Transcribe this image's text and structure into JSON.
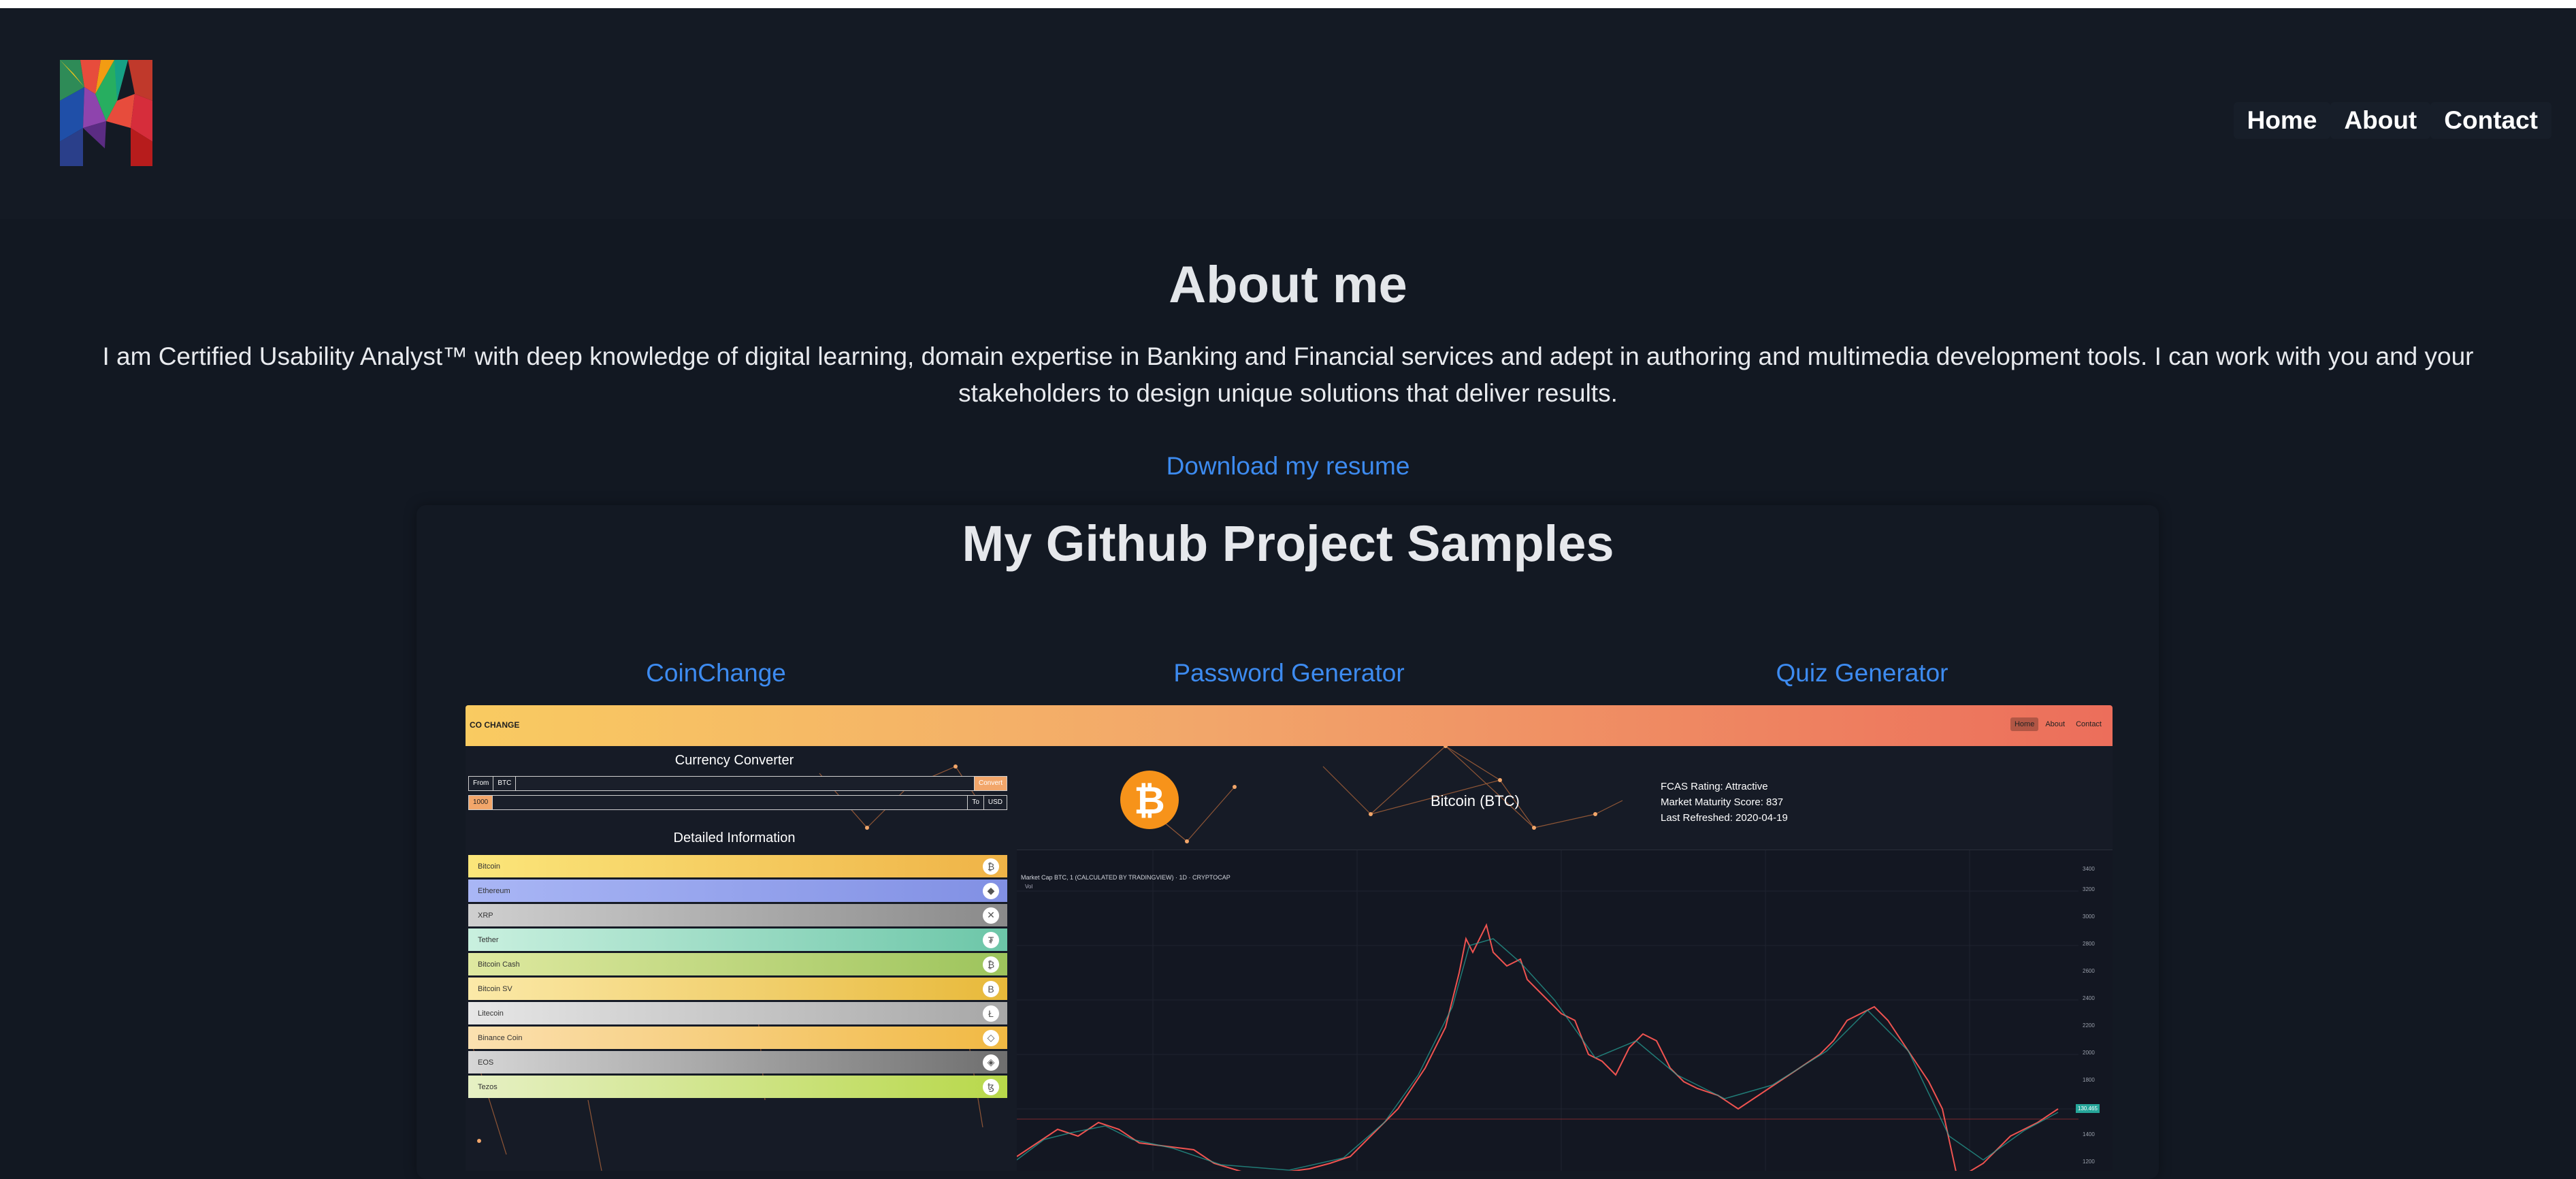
{
  "header": {
    "logo_alt": "M",
    "nav": [
      {
        "label": "Home"
      },
      {
        "label": "About"
      },
      {
        "label": "Contact"
      }
    ]
  },
  "about": {
    "title": "About me",
    "text": "I am Certified Usability Analyst™ with deep knowledge of digital learning, domain expertise in Banking and Financial services and adept in authoring and multimedia development tools. I can work with you and your stakeholders to design unique solutions that deliver results.",
    "resume_link": "Download my resume"
  },
  "github": {
    "title": "My Github Project Samples",
    "projects": [
      {
        "label": "CoinChange"
      },
      {
        "label": "Password Generator"
      },
      {
        "label": "Quiz Generator"
      }
    ]
  },
  "preview": {
    "brand": "CO   CHANGE",
    "nav": [
      "Home",
      "About",
      "Contact"
    ],
    "converter_title": "Currency Converter",
    "from_label": "From",
    "from_value": "BTC",
    "convert_label": "Convert",
    "amount_value": "1000",
    "to_label": "To",
    "to_value": "USD",
    "detail_title": "Detailed Information",
    "coins": [
      {
        "name": "Bitcoin",
        "icon": "₿",
        "color_a": "#fbe67a",
        "color_b": "#efb347"
      },
      {
        "name": "Ethereum",
        "icon": "◆",
        "color_a": "#a9b6f5",
        "color_b": "#8190e4"
      },
      {
        "name": "XRP",
        "icon": "✕",
        "color_a": "#cfcfcf",
        "color_b": "#8a8a8a"
      },
      {
        "name": "Tether",
        "icon": "₮",
        "color_a": "#c9f0df",
        "color_b": "#6cc6a8"
      },
      {
        "name": "Bitcoin Cash",
        "icon": "₿",
        "color_a": "#dfe9a0",
        "color_b": "#9dc45c"
      },
      {
        "name": "Bitcoin SV",
        "icon": "B",
        "color_a": "#fbe9a8",
        "color_b": "#e8b93a"
      },
      {
        "name": "Litecoin",
        "icon": "Ł",
        "color_a": "#e6e6e6",
        "color_b": "#a7a7a7"
      },
      {
        "name": "Binance Coin",
        "icon": "◇",
        "color_a": "#fbe0b0",
        "color_b": "#f1b943"
      },
      {
        "name": "EOS",
        "icon": "◈",
        "color_a": "#d6d6d6",
        "color_b": "#6f6f6f"
      },
      {
        "name": "Tezos",
        "icon": "ꜩ",
        "color_a": "#e6f0c4",
        "color_b": "#b8d84a"
      }
    ],
    "btc_name": "Bitcoin (BTC)",
    "btc_info": [
      "FCAS Rating: Attractive",
      "Market Maturity Score: 837",
      "Last Refreshed: 2020-04-19"
    ],
    "chart_legend": "Market Cap BTC, 1 (CALCULATED BY TRADINGVIEW) · 1D · CRYPTOCAP",
    "chart_legend2": "Vol",
    "chart_price": "130.465"
  }
}
